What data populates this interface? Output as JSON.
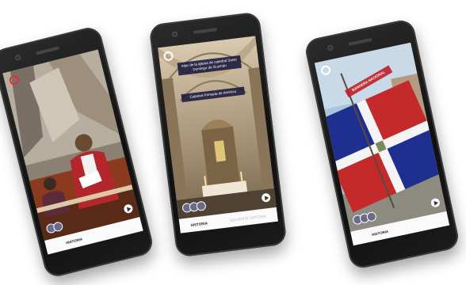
{
  "phones": [
    {
      "scene": "parliament",
      "nav": {
        "left": "HISTORIA",
        "right": ""
      }
    },
    {
      "scene": "cathedral",
      "caption_top": "Altar de la iglesia de catedral Santo Domingo de Guzmán",
      "caption_bottom": "Catedral Primada de América",
      "nav": {
        "left": "HISTORIA",
        "right": "SIGUIENTE HISTORIA"
      }
    },
    {
      "scene": "flag",
      "banner": "BANDERA NACIONAL",
      "nav": {
        "left": "HISTORIA",
        "right": ""
      }
    }
  ],
  "colors": {
    "flag_blue": "#1f2f8f",
    "flag_red": "#c42a2a",
    "robe_red": "#b3262c",
    "caption_bg": "#1e1e4a"
  }
}
